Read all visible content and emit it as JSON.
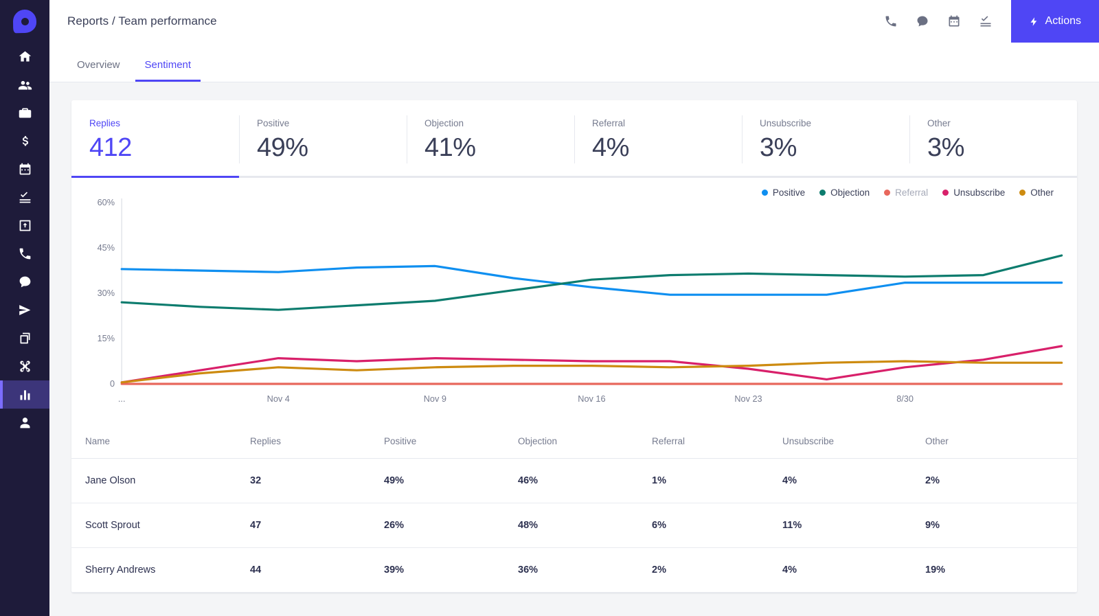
{
  "brand": {
    "logo_name": "drop-logo",
    "accent": "#4f46f5"
  },
  "sidebar": {
    "items": [
      {
        "icon": "home-icon",
        "name": "home"
      },
      {
        "icon": "people-icon",
        "name": "contacts"
      },
      {
        "icon": "briefcase-icon",
        "name": "companies"
      },
      {
        "icon": "dollar-icon",
        "name": "deals"
      },
      {
        "icon": "calendar-icon",
        "name": "calendar"
      },
      {
        "icon": "tasks-icon",
        "name": "tasks"
      },
      {
        "icon": "inbox-import-icon",
        "name": "import"
      },
      {
        "icon": "phone-icon",
        "name": "calls"
      },
      {
        "icon": "chat-icon",
        "name": "conversations"
      },
      {
        "icon": "send-icon",
        "name": "campaigns"
      },
      {
        "icon": "copy-icon",
        "name": "templates"
      },
      {
        "icon": "scissors-icon",
        "name": "snippets"
      },
      {
        "icon": "bar-chart-icon",
        "name": "reports",
        "active": true
      },
      {
        "icon": "person-icon",
        "name": "profile"
      }
    ]
  },
  "header": {
    "breadcrumb": "Reports / Team performance",
    "icons": [
      {
        "icon": "phone-icon",
        "name": "call"
      },
      {
        "icon": "chat-icon",
        "name": "chat"
      },
      {
        "icon": "calendar-icon",
        "name": "calendar"
      },
      {
        "icon": "tasks-icon",
        "name": "tasks"
      }
    ],
    "actions_label": "Actions",
    "actions_icon": "bolt-icon"
  },
  "tabs": [
    {
      "label": "Overview",
      "active": false
    },
    {
      "label": "Sentiment",
      "active": true
    }
  ],
  "kpis": [
    {
      "label": "Replies",
      "value": "412",
      "active": true
    },
    {
      "label": "Positive",
      "value": "49%",
      "active": false
    },
    {
      "label": "Objection",
      "value": "41%",
      "active": false
    },
    {
      "label": "Referral",
      "value": "4%",
      "active": false
    },
    {
      "label": "Unsubscribe",
      "value": "3%",
      "active": false
    },
    {
      "label": "Other",
      "value": "3%",
      "active": false
    }
  ],
  "chart_data": {
    "type": "line",
    "title": "",
    "xlabel": "",
    "ylabel": "",
    "ylim": [
      0,
      60
    ],
    "yticks": [
      0,
      15,
      30,
      45,
      60
    ],
    "ytick_labels": [
      "0",
      "15%",
      "30%",
      "45%",
      "60%"
    ],
    "grid": false,
    "legend_position": "top-right",
    "x": [
      0,
      1,
      2,
      3,
      4,
      5,
      6,
      7,
      8,
      9,
      10,
      11,
      12
    ],
    "xtick_positions": [
      0,
      2,
      4,
      6,
      8,
      10
    ],
    "xtick_labels": [
      "...",
      "Nov 4",
      "Nov 9",
      "Nov 16",
      "Nov 23",
      "8/30"
    ],
    "series": [
      {
        "name": "Positive",
        "color": "#0f8ff0",
        "muted": false,
        "values": [
          38,
          37.5,
          37,
          38.5,
          39,
          35,
          32,
          29.5,
          29.5,
          29.5,
          33.5,
          33.5,
          33.5
        ]
      },
      {
        "name": "Objection",
        "color": "#0d7c6e",
        "muted": false,
        "values": [
          27,
          25.5,
          24.5,
          26,
          27.5,
          31,
          34.5,
          36,
          36.5,
          36,
          35.5,
          36,
          42.5
        ]
      },
      {
        "name": "Referral",
        "color": "#e8675c",
        "muted": true,
        "values": [
          0,
          0,
          0,
          0,
          0,
          0,
          0,
          0,
          0,
          0,
          0,
          0,
          0
        ]
      },
      {
        "name": "Unsubscribe",
        "color": "#d8206a",
        "muted": false,
        "values": [
          0.5,
          4.5,
          8.5,
          7.5,
          8.5,
          8,
          7.5,
          7.5,
          5,
          1.5,
          5.5,
          8,
          12.5
        ]
      },
      {
        "name": "Other",
        "color": "#cd8b10",
        "muted": false,
        "values": [
          0.5,
          3.5,
          5.5,
          4.5,
          5.5,
          6,
          6,
          5.5,
          6,
          7,
          7.5,
          7,
          7
        ]
      }
    ]
  },
  "table": {
    "columns": [
      "Name",
      "Replies",
      "Positive",
      "Objection",
      "Referral",
      "Unsubscribe",
      "Other"
    ],
    "rows": [
      {
        "name": "Jane Olson",
        "replies": "32",
        "positive": "49%",
        "objection": "46%",
        "referral": "1%",
        "unsubscribe": "4%",
        "other": "2%"
      },
      {
        "name": "Scott Sprout",
        "replies": "47",
        "positive": "26%",
        "objection": "48%",
        "referral": "6%",
        "unsubscribe": "11%",
        "other": "9%"
      },
      {
        "name": "Sherry Andrews",
        "replies": "44",
        "positive": "39%",
        "objection": "36%",
        "referral": "2%",
        "unsubscribe": "4%",
        "other": "19%"
      }
    ]
  }
}
